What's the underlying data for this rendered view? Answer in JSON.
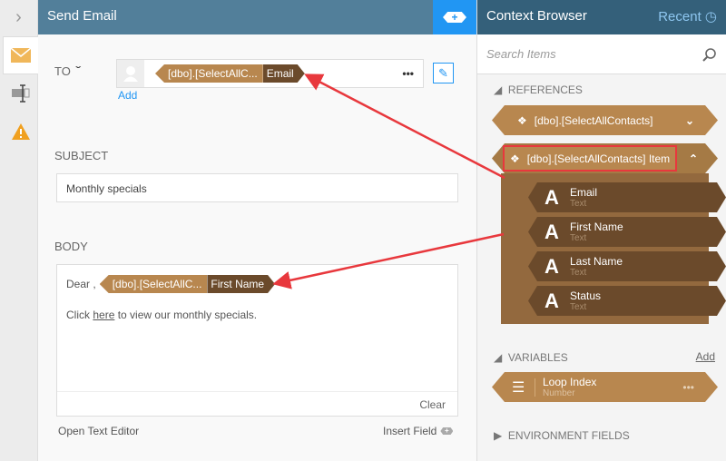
{
  "header": {
    "title": "Send Email"
  },
  "to": {
    "label": "TO",
    "tag_source": "[dbo].[SelectAllC...",
    "tag_field": "Email",
    "add_link": "Add",
    "more": "•••"
  },
  "subject": {
    "label": "SUBJECT",
    "value": "Monthly specials"
  },
  "body": {
    "label": "BODY",
    "greeting": "Dear ,",
    "tag_source": "[dbo].[SelectAllC...",
    "tag_field": "First Name",
    "line_prefix": "Click",
    "link": "here",
    "line_suffix": "to view our monthly specials.",
    "clear": "Clear",
    "open_editor": "Open Text Editor",
    "insert_field": "Insert Field"
  },
  "context": {
    "title": "Context Browser",
    "recent": "Recent",
    "search_placeholder": "Search Items",
    "references_label": "REFERENCES",
    "ref1": "[dbo].[SelectAllContacts]",
    "ref2": "[dbo].[SelectAllContacts] Item",
    "fields": [
      {
        "name": "Email",
        "type": "Text"
      },
      {
        "name": "First Name",
        "type": "Text"
      },
      {
        "name": "Last Name",
        "type": "Text"
      },
      {
        "name": "Status",
        "type": "Text"
      }
    ],
    "variables_label": "VARIABLES",
    "variables_add": "Add",
    "variable": {
      "name": "Loop Index",
      "type": "Number"
    },
    "env_label": "ENVIRONMENT FIELDS"
  },
  "colors": {
    "header": "#527f9a",
    "accent": "#2196f3",
    "tag": "#b8874f",
    "tag_dark": "#6b4a2b",
    "annotation": "#e8383d"
  }
}
